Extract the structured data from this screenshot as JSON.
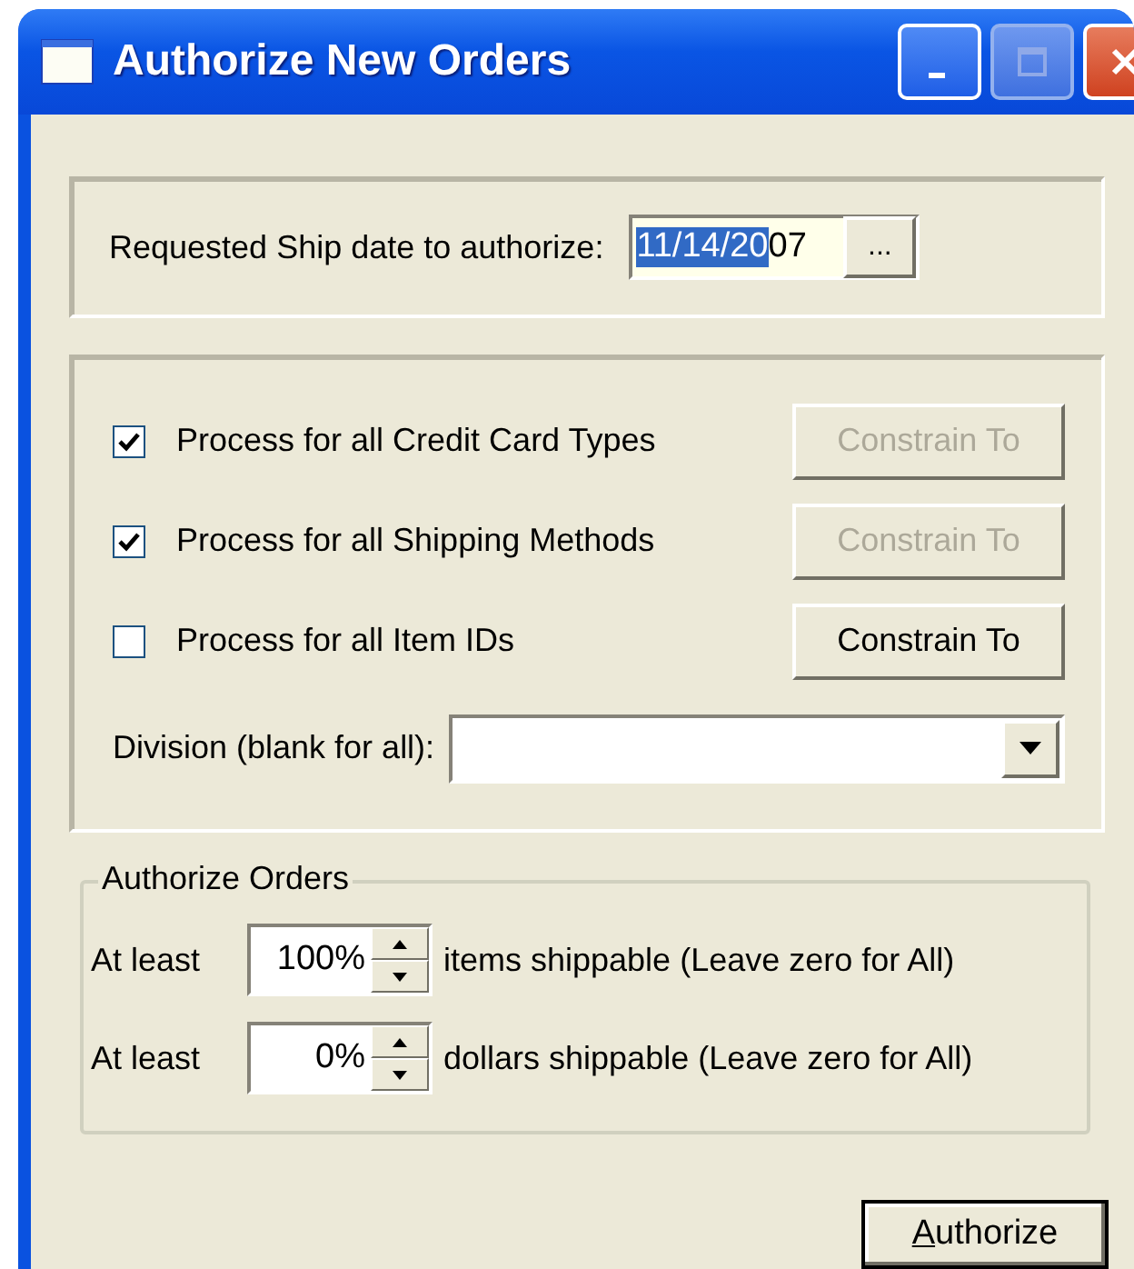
{
  "window": {
    "title": "Authorize New Orders"
  },
  "ship_date": {
    "label": "Requested Ship date to authorize:",
    "value_selected": "11/14/20",
    "value_rest": "07",
    "browse_button": "..."
  },
  "options": [
    {
      "label": "Process for all Credit Card Types",
      "checked": true,
      "button": {
        "label": "Constrain To",
        "disabled": true
      }
    },
    {
      "label": "Process for all Shipping Methods",
      "checked": true,
      "button": {
        "label": "Constrain To",
        "disabled": true
      }
    },
    {
      "label": "Process for all Item IDs",
      "checked": false,
      "button": {
        "label": "Constrain To",
        "disabled": false
      }
    }
  ],
  "division": {
    "label": "Division (blank for all):"
  },
  "authorize_orders": {
    "title": "Authorize Orders",
    "rows": [
      {
        "prefix": "At least",
        "value": "100%",
        "suffix": "items shippable (Leave zero for All)"
      },
      {
        "prefix": "At least",
        "value": "0%",
        "suffix": "dollars shippable (Leave zero for All)"
      }
    ]
  },
  "authorize_button": {
    "label": "Authorize"
  }
}
